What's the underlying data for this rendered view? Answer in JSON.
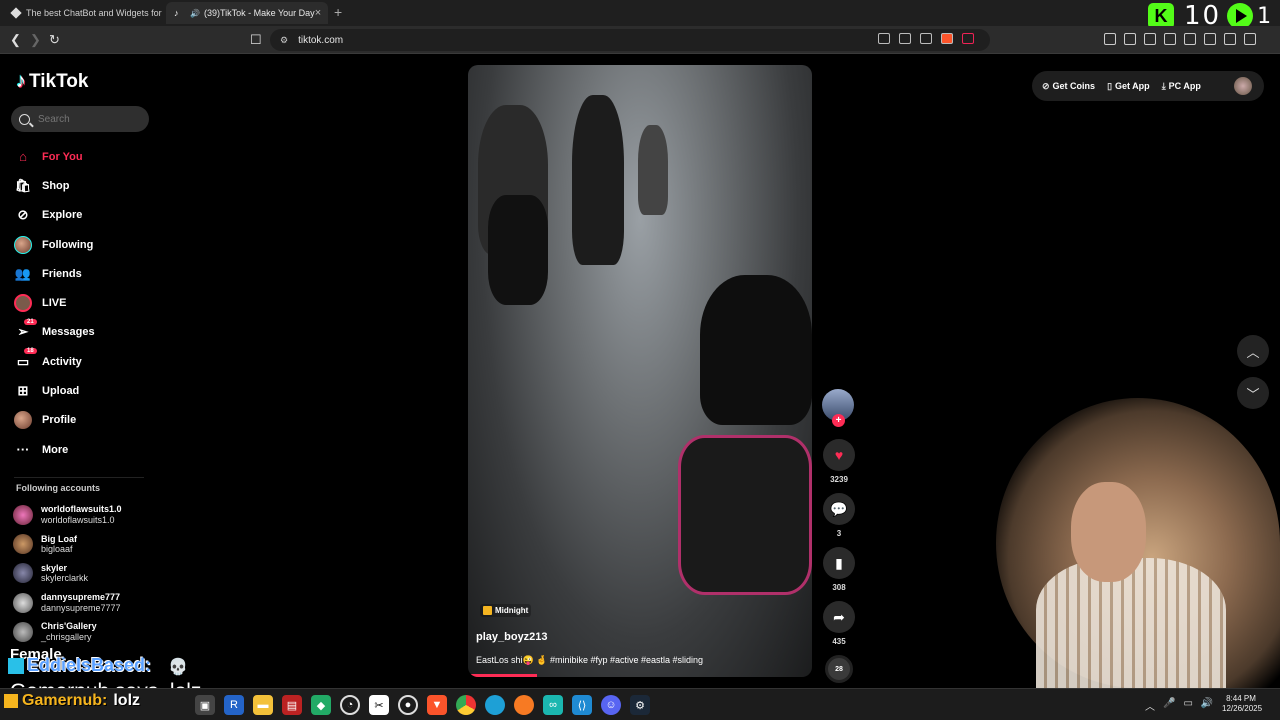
{
  "browser": {
    "tabs": [
      {
        "title": "The best ChatBot and Widgets for Ki"
      },
      {
        "title": "(39)TikTok - Make Your Day"
      }
    ],
    "new_tab": "+",
    "url": "tiktok.com"
  },
  "kick_overlay": {
    "count_left": "10",
    "count_right": "1"
  },
  "sidebar": {
    "logo": "TikTok",
    "search_placeholder": "Search",
    "nav": [
      {
        "label": "For You",
        "icon": "home-icon",
        "active": true
      },
      {
        "label": "Shop",
        "icon": "shop-icon"
      },
      {
        "label": "Explore",
        "icon": "compass-icon"
      },
      {
        "label": "Following",
        "icon": "following-avatar-icon"
      },
      {
        "label": "Friends",
        "icon": "friends-icon"
      },
      {
        "label": "LIVE",
        "icon": "live-icon"
      },
      {
        "label": "Messages",
        "icon": "messages-icon",
        "badge": "21"
      },
      {
        "label": "Activity",
        "icon": "activity-icon",
        "badge": "18"
      },
      {
        "label": "Upload",
        "icon": "upload-icon"
      },
      {
        "label": "Profile",
        "icon": "profile-avatar-icon"
      },
      {
        "label": "More",
        "icon": "more-icon"
      }
    ],
    "following_title": "Following accounts",
    "accounts": [
      {
        "name": "worldoflawsuits1.0",
        "handle": "worldoflawsuits1.0"
      },
      {
        "name": "Big Loaf",
        "handle": "bigloaaf"
      },
      {
        "name": "skyler",
        "handle": "skylerclarkk"
      },
      {
        "name": "dannysupreme777",
        "handle": "dannysupreme7777"
      },
      {
        "name": "Chris'Gallery",
        "handle": "_chrisgallery"
      }
    ]
  },
  "video": {
    "music_tag": "Midnight",
    "username": "play_boyz213",
    "caption": "EastLos shi😜 🤞 #minibike #fyp #active #eastla #sliding",
    "progress": 0.2
  },
  "actions": {
    "likes": "3239",
    "comments": "3",
    "saves": "308",
    "shares": "435",
    "music_disc": "28"
  },
  "topright": {
    "get_coins": "Get Coins",
    "get_app": "Get App",
    "pc_app": "PC App"
  },
  "stream_overlay": {
    "female_label": "Female",
    "chat_user1": "EddieIsBased:",
    "chat_line1": "Gamernub says, lolz",
    "chat_user2": "Gamernub:",
    "chat_msg2": "lolz"
  },
  "taskbar": {
    "time": "8:44 PM",
    "date": "12/26/2025"
  },
  "colors": {
    "accent": "#fe2c55",
    "kick_green": "#53fc18",
    "background": "#000000"
  }
}
